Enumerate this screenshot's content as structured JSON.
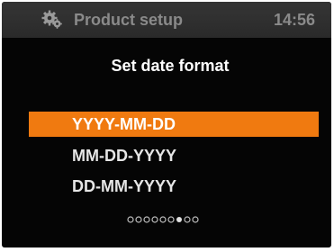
{
  "header": {
    "title": "Product setup",
    "time": "14:56",
    "icon": "gear-icon"
  },
  "subtitle": "Set date format",
  "options": [
    {
      "label": "YYYY-MM-DD",
      "selected": true
    },
    {
      "label": "MM-DD-YYYY",
      "selected": false
    },
    {
      "label": "DD-MM-YYYY",
      "selected": false
    }
  ],
  "page_indicator": {
    "total": 9,
    "current": 7
  },
  "colors": {
    "highlight": "#f07a10",
    "header_bg": "#2f2f2f",
    "screen_bg": "#050505"
  }
}
